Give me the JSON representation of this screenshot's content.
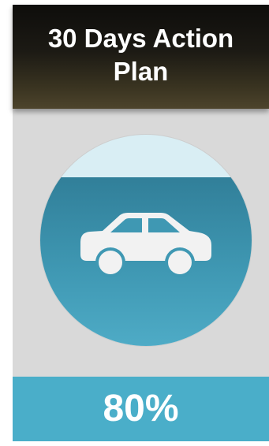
{
  "header": {
    "title": "30 Days Action Plan"
  },
  "gauge": {
    "icon": "car-icon",
    "progress": 0.8,
    "colors": {
      "empty": "#d9eef4",
      "filled": "#3f98b3",
      "icon": "#f2f2f2"
    }
  },
  "progress": {
    "label": "80%"
  },
  "colors": {
    "header_top": "#0e0d0b",
    "header_bottom": "#4d442c",
    "card_background": "#d9d9d9",
    "percent_bar": "#4aaec9"
  }
}
